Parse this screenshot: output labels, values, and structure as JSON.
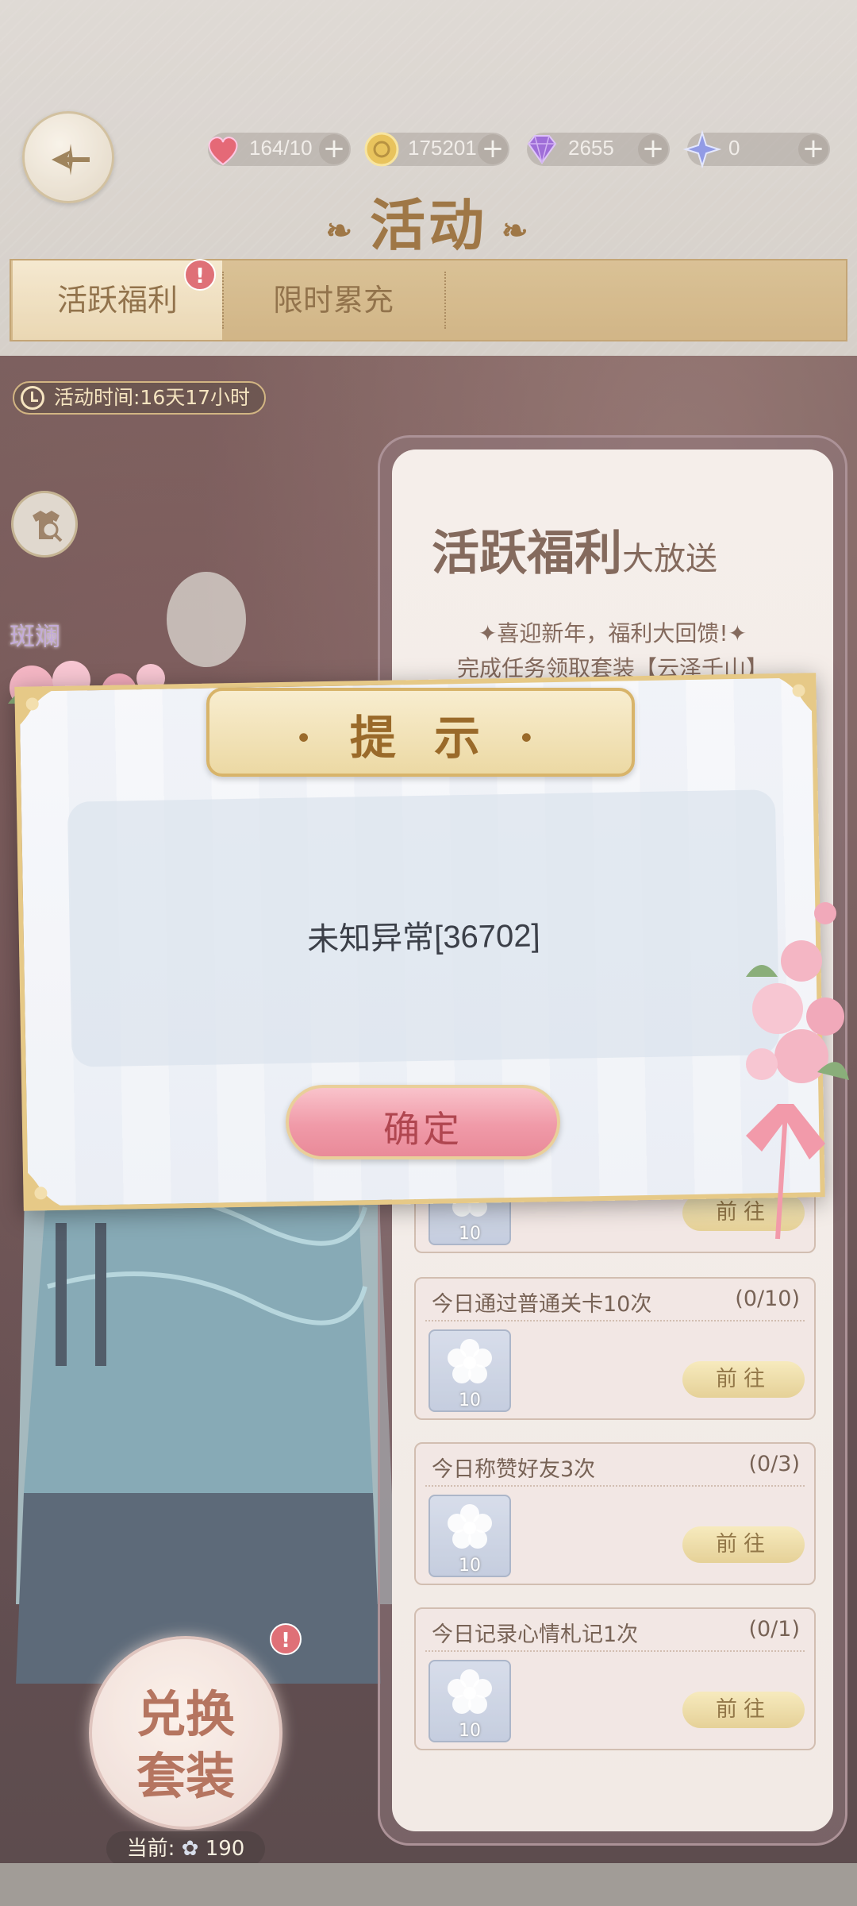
{
  "header": {
    "title": "活动",
    "resources": [
      {
        "name": "stamina",
        "icon": "heart-icon",
        "value": "164/10",
        "color": "#e0485a"
      },
      {
        "name": "coins",
        "icon": "coin-icon",
        "value": "175201",
        "color": "#e3b63a"
      },
      {
        "name": "diamonds",
        "icon": "diamond-icon",
        "value": "2655",
        "color": "#8a4fd0"
      },
      {
        "name": "stars",
        "icon": "star-icon",
        "value": "0",
        "color": "#7a86e0"
      }
    ],
    "tabs": [
      {
        "label": "活跃福利",
        "active": true,
        "badge": "!"
      },
      {
        "label": "限时累充",
        "active": false
      }
    ]
  },
  "event": {
    "timer_label": "活动时间:16天17小时",
    "character_name": "斑斓",
    "panel_title_main": "活跃福利",
    "panel_title_sub": "大放送",
    "panel_line1": "✦喜迎新年，福利大回馈!✦",
    "panel_line2": "完成任务领取套装【云泽千山】",
    "quests": [
      {
        "title": "",
        "progress": "",
        "reward_count": "10",
        "go_label": "前往"
      },
      {
        "title": "今日通过普通关卡10次",
        "progress": "(0/10)",
        "reward_count": "10",
        "go_label": "前往"
      },
      {
        "title": "今日称赞好友3次",
        "progress": "(0/3)",
        "reward_count": "10",
        "go_label": "前往"
      },
      {
        "title": "今日记录心情札记1次",
        "progress": "(0/1)",
        "reward_count": "10",
        "go_label": "前往"
      }
    ],
    "exchange_line1": "兑换",
    "exchange_line2": "套装",
    "exchange_badge": "!",
    "current_label": "当前:",
    "current_value": "190"
  },
  "dialog": {
    "title": "· 提 示 ·",
    "message": "未知异常[36702]",
    "confirm_label": "确定"
  }
}
